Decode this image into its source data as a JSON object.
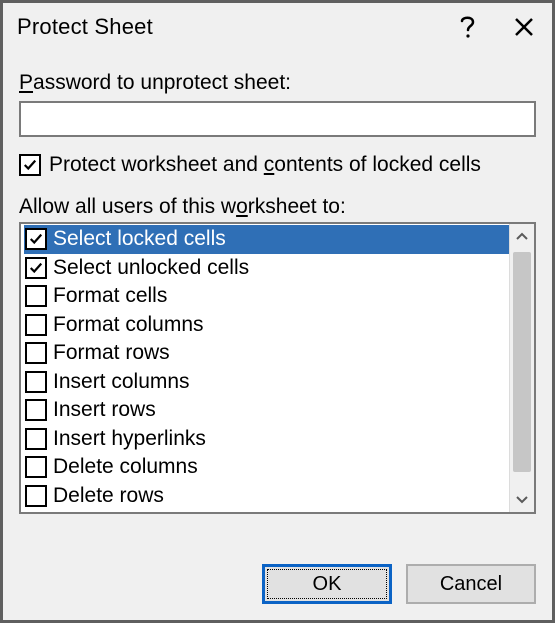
{
  "dialog": {
    "title": "Protect Sheet"
  },
  "password": {
    "label_prefix_underlined": "P",
    "label_rest": "assword to unprotect sheet:",
    "value": ""
  },
  "protect": {
    "checked": true,
    "label_before_c": "Protect worksheet and ",
    "label_c": "c",
    "label_after_c": "ontents of locked cells"
  },
  "allow": {
    "label_before": "Allow all users of this w",
    "label_o": "o",
    "label_after": "rksheet to:"
  },
  "permissions": [
    {
      "label": "Select locked cells",
      "checked": true,
      "selected": true
    },
    {
      "label": "Select unlocked cells",
      "checked": true,
      "selected": false
    },
    {
      "label": "Format cells",
      "checked": false,
      "selected": false
    },
    {
      "label": "Format columns",
      "checked": false,
      "selected": false
    },
    {
      "label": "Format rows",
      "checked": false,
      "selected": false
    },
    {
      "label": "Insert columns",
      "checked": false,
      "selected": false
    },
    {
      "label": "Insert rows",
      "checked": false,
      "selected": false
    },
    {
      "label": "Insert hyperlinks",
      "checked": false,
      "selected": false
    },
    {
      "label": "Delete columns",
      "checked": false,
      "selected": false
    },
    {
      "label": "Delete rows",
      "checked": false,
      "selected": false
    }
  ],
  "buttons": {
    "ok": "OK",
    "cancel": "Cancel"
  }
}
